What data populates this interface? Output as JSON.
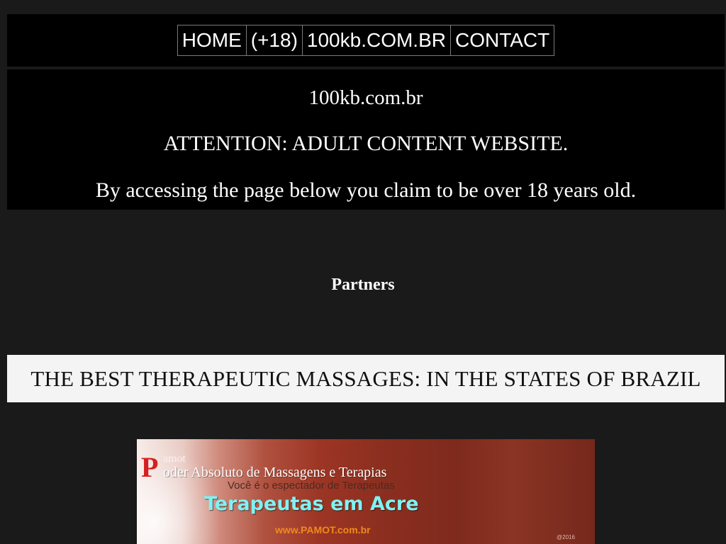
{
  "nav": {
    "items": [
      {
        "label": "HOME"
      },
      {
        "label": "(+18)"
      },
      {
        "label": "100kb.COM.BR"
      },
      {
        "label": "CONTACT"
      }
    ]
  },
  "notice": {
    "site_name": "100kb.com.br",
    "attention": "ATTENTION: ADULT CONTENT WEBSITE.",
    "age_claim": "By accessing the page below you claim to be over 18 years old."
  },
  "partners": {
    "heading": "Partners"
  },
  "massage_strip": {
    "title": "THE BEST THERAPEUTIC MASSAGES: IN THE STATES OF BRAZIL"
  },
  "pamot_banner": {
    "big_letter": "P",
    "brand_small": "amot",
    "tagline": "oder Absoluto de Massagens e Terapias",
    "subtitle": "Você é o espectador de Terapeutas",
    "headline": "Terapeutas em Acre",
    "url": "www.PAMOT.com.br",
    "year": "@2016"
  },
  "colors": {
    "page_background": "#1a1a1a",
    "panel_background": "#000000",
    "strip_background": "#f4f4f4",
    "nav_border": "#7a7a7a",
    "banner_red": "#d61f1f",
    "banner_headline": "#7ff2f2",
    "banner_url": "#f08a1c"
  }
}
